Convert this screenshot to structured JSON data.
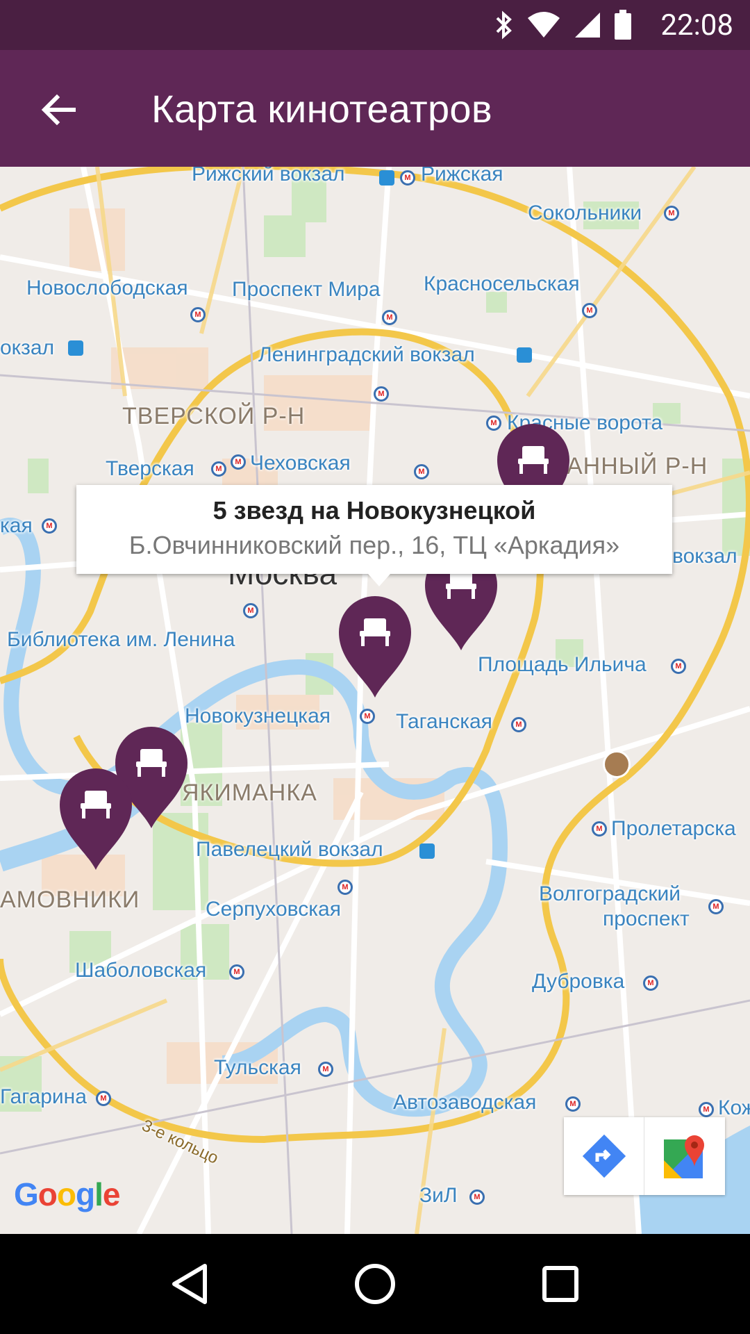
{
  "status_bar": {
    "time": "22:08"
  },
  "app_bar": {
    "title": "Карта кинотеатров"
  },
  "map": {
    "labels": {
      "rizhsky_vokzal": "Рижский вокзал",
      "rizhskaya": "Рижская",
      "sokolniki": "Сокольники",
      "novoslobodskaya": "Новослободская",
      "prospekt_mira": "Проспект Мира",
      "krasnoselskaya": "Красносельская",
      "vokzal_left": "окзал",
      "leningradsky_vokzal": "Ленинградский вокзал",
      "tverskoy": "ТВЕРСКОЙ Р-Н",
      "krasnye_vorota": "Красные ворота",
      "tverskaya": "Тверская",
      "chekhovskaya": "Чеховская",
      "basmanny": "БАСМАННЫЙ Р-Н",
      "kaya_left": "кая",
      "vokzal_right": "вокзал",
      "moskva": "Москва",
      "biblioteka": "Библиотека им. Ленина",
      "ploshchad_ilicha": "Площадь Ильича",
      "novokuznetskaya": "Новокузнецкая",
      "taganskaya": "Таганская",
      "yakimanka": "ЯКИМАНКА",
      "proletarskaya": "Пролетарска",
      "paveletsky_vokzal": "Павелецкий вокзал",
      "khamovniki": "АМОВНИКИ",
      "volgogradsky": "Волгоградский",
      "prospekt": "проспект",
      "serpukhovskaya": "Серпуховская",
      "shabolovskaya": "Шаболовская",
      "dubrovka": "Дубровка",
      "tulskaya": "Тульская",
      "gagarina": "Гагарина",
      "avtozavodskaya": "Автозаводская",
      "kozh": "Кож",
      "ring3": "3-е кольцо",
      "zil": "ЗиЛ"
    },
    "info_window": {
      "title": "5 звезд на Новокузнецкой",
      "address": "Б.Овчинниковский пер., 16, ТЦ «Аркадия»"
    },
    "marker_color": "#5f2756",
    "attribution": "Google"
  },
  "colors": {
    "status_bar": "#4a1f42",
    "app_bar": "#5f2756",
    "metro_label": "#3a84c0"
  }
}
